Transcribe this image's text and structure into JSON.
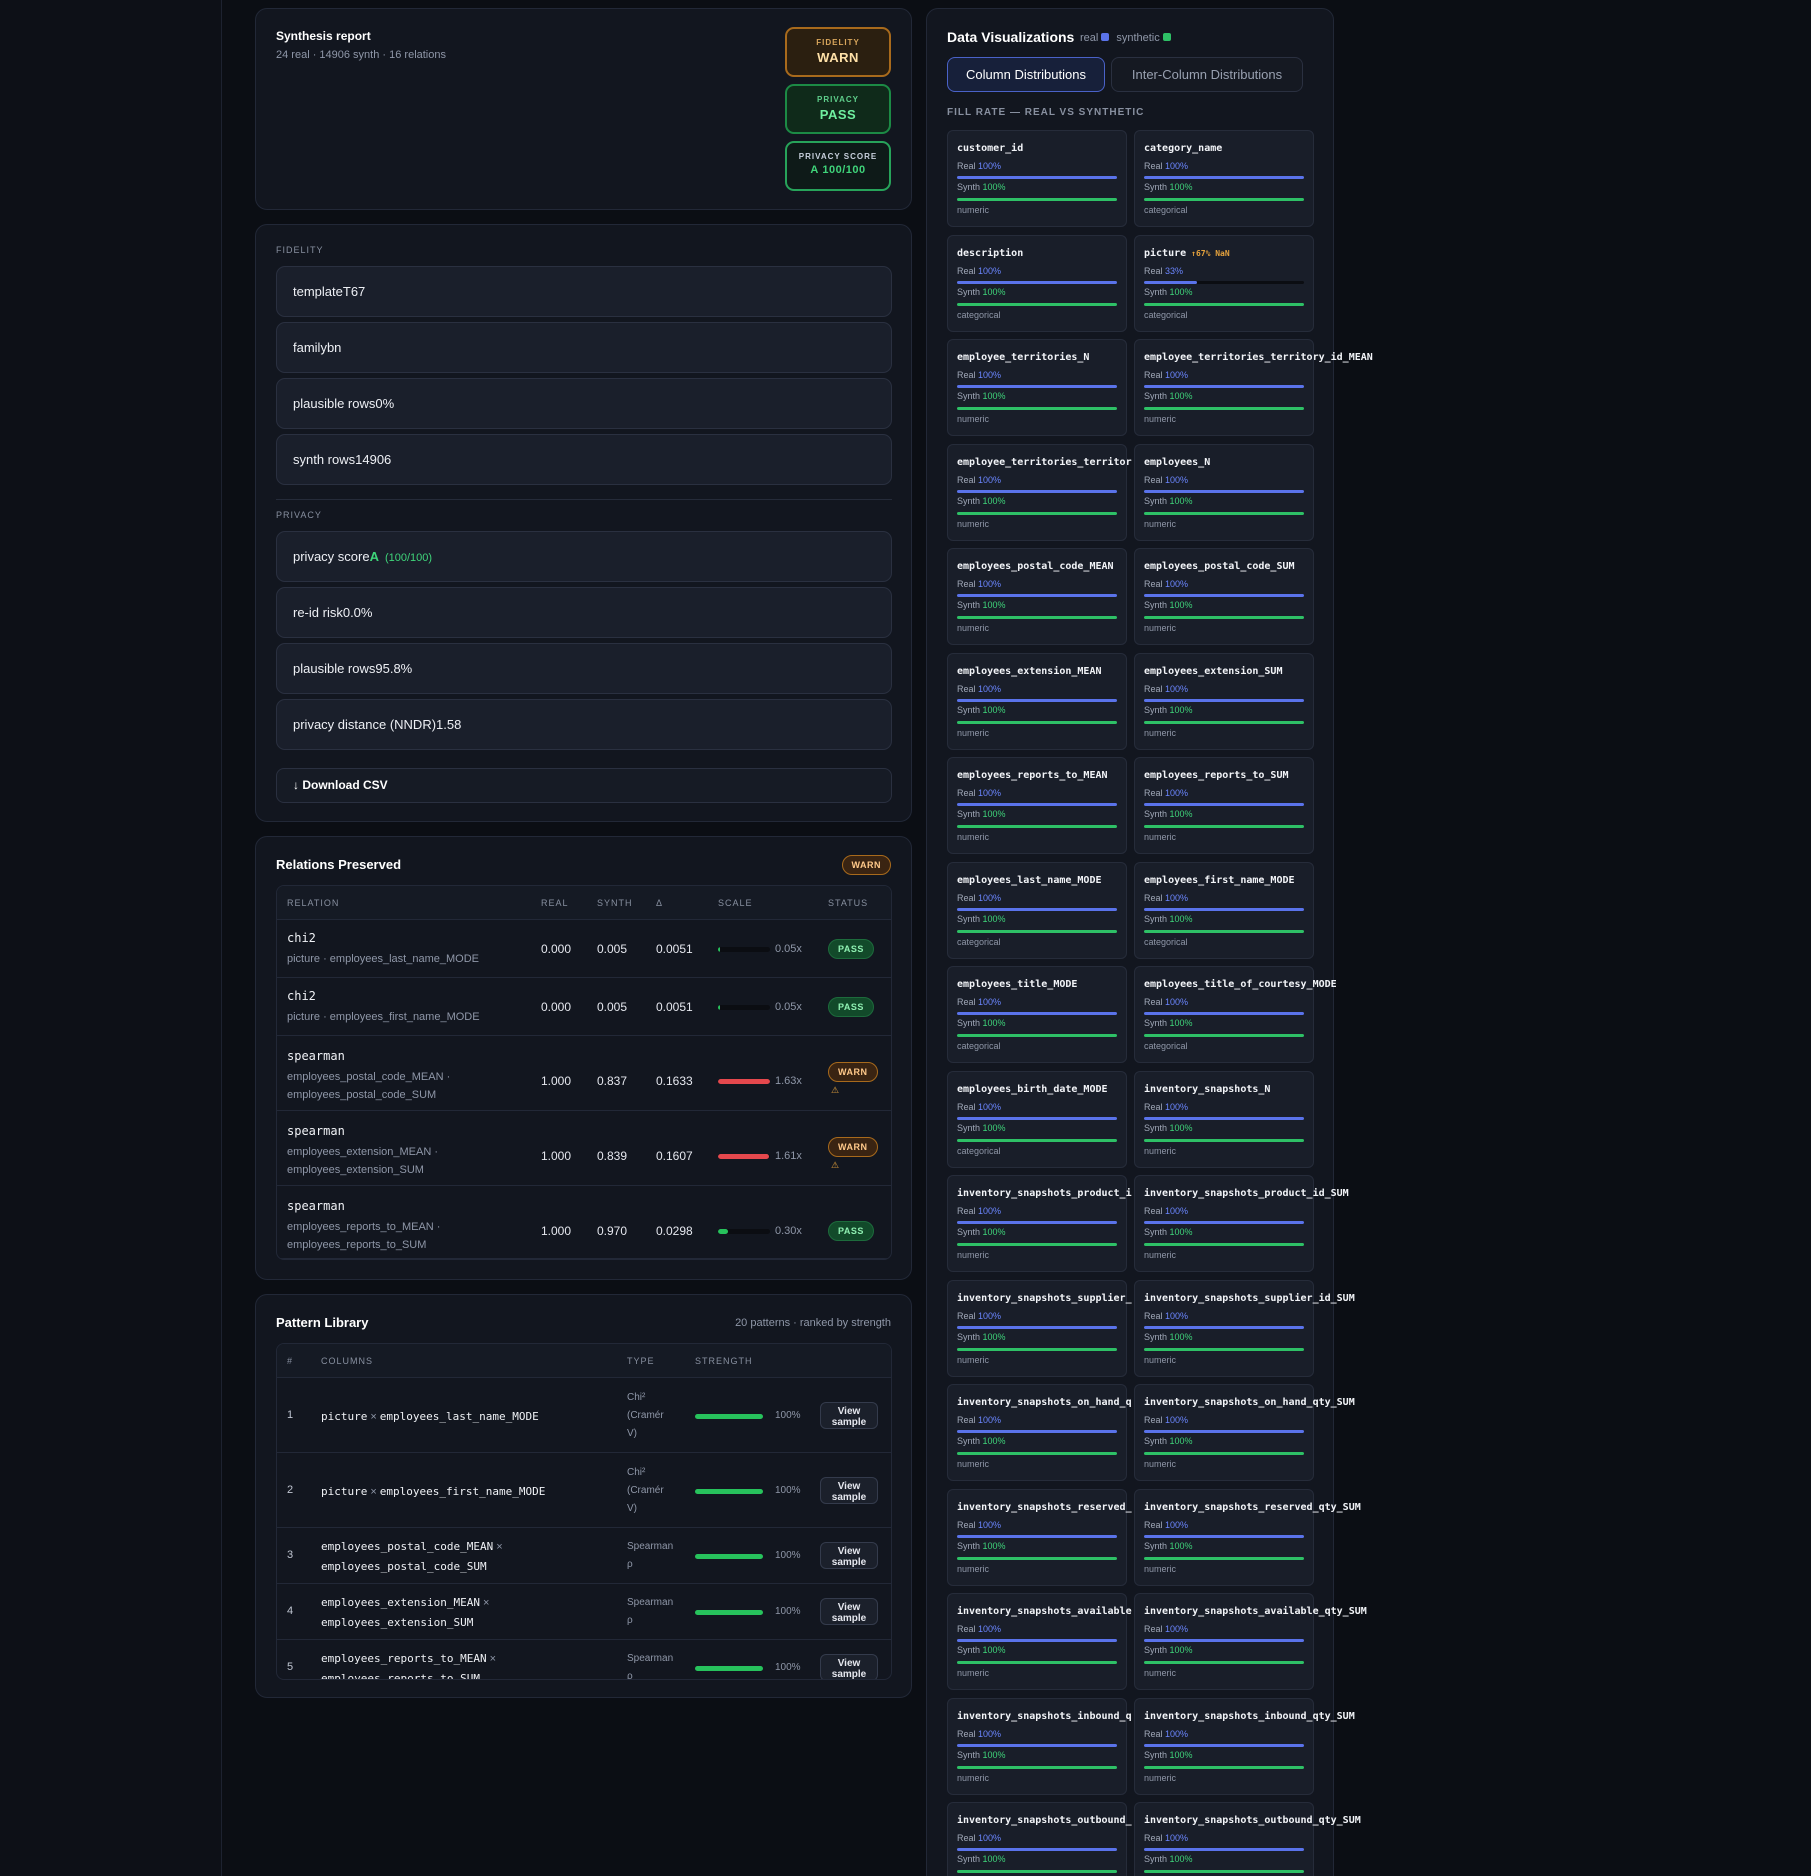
{
  "report": {
    "title": "Synthesis report",
    "subtitle": "24 real · 14906 synth · 16 relations",
    "badges": [
      {
        "label": "FIDELITY",
        "value": "WARN"
      },
      {
        "label": "PRIVACY",
        "value": "PASS"
      },
      {
        "label": "PRIVACY SCORE",
        "grade": "A",
        "value": "100/100"
      }
    ]
  },
  "metrics": {
    "fidelity_header": "FIDELITY",
    "fidelity": [
      {
        "label": "template",
        "value": "T67"
      },
      {
        "label": "family",
        "value": "bn"
      },
      {
        "label": "plausible rows",
        "value": "0%"
      },
      {
        "label": "synth rows",
        "value": "14906"
      }
    ],
    "privacy_header": "PRIVACY",
    "privacy_score": {
      "label": "privacy score",
      "grade": "A",
      "sub": "(100/100)"
    },
    "privacy": [
      {
        "label": "re-id risk",
        "value": "0.0%"
      },
      {
        "label": "plausible rows",
        "value": "95.8%"
      },
      {
        "label": "privacy distance (NNDR)",
        "value": "1.58"
      }
    ],
    "download_label": "↓ Download CSV"
  },
  "relations": {
    "title": "Relations Preserved",
    "status_badge": "WARN",
    "headers": [
      "RELATION",
      "REAL",
      "SYNTH",
      "Δ",
      "SCALE",
      "STATUS"
    ],
    "rows": [
      {
        "name": "chi2",
        "cols": [
          "picture · employees_last_name_MODE"
        ],
        "real": "0.000",
        "synth": "0.005",
        "delta": "0.0051",
        "scale_label": "0.05x",
        "scale": 0.05,
        "status": "PASS",
        "warn_icon": ""
      },
      {
        "name": "chi2",
        "cols": [
          "picture · employees_first_name_MODE"
        ],
        "real": "0.000",
        "synth": "0.005",
        "delta": "0.0051",
        "scale_label": "0.05x",
        "scale": 0.05,
        "status": "PASS",
        "warn_icon": ""
      },
      {
        "name": "spearman",
        "cols": [
          "employees_postal_code_MEAN ·",
          "employees_postal_code_SUM"
        ],
        "real": "1.000",
        "synth": "0.837",
        "delta": "0.1633",
        "scale_label": "1.63x",
        "scale": 1.63,
        "status": "WARN",
        "warn_icon": "⚠"
      },
      {
        "name": "spearman",
        "cols": [
          "employees_extension_MEAN ·",
          "employees_extension_SUM"
        ],
        "real": "1.000",
        "synth": "0.839",
        "delta": "0.1607",
        "scale_label": "1.61x",
        "scale": 1.61,
        "status": "WARN",
        "warn_icon": "⚠"
      },
      {
        "name": "spearman",
        "cols": [
          "employees_reports_to_MEAN ·",
          "employees_reports_to_SUM"
        ],
        "real": "1.000",
        "synth": "0.970",
        "delta": "0.0298",
        "scale_label": "0.30x",
        "scale": 0.3,
        "status": "PASS",
        "warn_icon": ""
      }
    ]
  },
  "patterns": {
    "title": "Pattern Library",
    "subtitle": "20 patterns · ranked by strength",
    "headers": [
      "#",
      "COLUMNS",
      "TYPE",
      "STRENGTH"
    ],
    "rows": [
      {
        "n": "1",
        "a": "picture",
        "b": "employees_last_name_MODE",
        "type": [
          "Chi²",
          "(Cramér",
          "V)"
        ],
        "strength": "100%",
        "button": "View sample"
      },
      {
        "n": "2",
        "a": "picture",
        "b": "employees_first_name_MODE",
        "type": [
          "Chi²",
          "(Cramér",
          "V)"
        ],
        "strength": "100%",
        "button": "View sample"
      },
      {
        "n": "3",
        "a": "employees_postal_code_MEAN",
        "b": "employees_postal_code_SUM",
        "type": [
          "Spearman",
          "ρ"
        ],
        "strength": "100%",
        "button": "View sample"
      },
      {
        "n": "4",
        "a": "employees_extension_MEAN",
        "b": "employees_extension_SUM",
        "type": [
          "Spearman",
          "ρ"
        ],
        "strength": "100%",
        "button": "View sample"
      },
      {
        "n": "5",
        "a": "employees_reports_to_MEAN",
        "b": "employees_reports_to_SUM",
        "type": [
          "Spearman",
          "ρ"
        ],
        "strength": "100%",
        "button": "View sample"
      }
    ],
    "times": "×"
  },
  "viz": {
    "title": "Data Visualizations",
    "legend_real": "real",
    "legend_synth": "synthetic",
    "colors": {
      "real": "#5a73ea",
      "synth": "#2ec066"
    },
    "tabs": [
      "Column Distributions",
      "Inter-Column Distributions"
    ],
    "section": "FILL RATE — REAL VS SYNTHETIC",
    "real_label": "Real",
    "synth_label": "Synth",
    "columns": [
      {
        "name": "customer_id",
        "real": "100%",
        "synth": "100%",
        "real_fill": 1,
        "synth_fill": 1,
        "type": "numeric",
        "nan": ""
      },
      {
        "name": "category_name",
        "real": "100%",
        "synth": "100%",
        "real_fill": 1,
        "synth_fill": 1,
        "type": "categorical",
        "nan": ""
      },
      {
        "name": "description",
        "real": "100%",
        "synth": "100%",
        "real_fill": 1,
        "synth_fill": 1,
        "type": "categorical",
        "nan": ""
      },
      {
        "name": "picture",
        "real": "33%",
        "synth": "100%",
        "real_fill": 0.33,
        "synth_fill": 1,
        "type": "categorical",
        "nan": "↑67% NaN"
      },
      {
        "name": "employee_territories_N",
        "real": "100%",
        "synth": "100%",
        "real_fill": 1,
        "synth_fill": 1,
        "type": "numeric",
        "nan": ""
      },
      {
        "name": "employee_territories_territory_id_MEAN",
        "real": "100%",
        "synth": "100%",
        "real_fill": 1,
        "synth_fill": 1,
        "type": "numeric",
        "nan": ""
      },
      {
        "name": "employee_territories_territor",
        "real": "100%",
        "synth": "100%",
        "real_fill": 1,
        "synth_fill": 1,
        "type": "numeric",
        "nan": ""
      },
      {
        "name": "employees_N",
        "real": "100%",
        "synth": "100%",
        "real_fill": 1,
        "synth_fill": 1,
        "type": "numeric",
        "nan": ""
      },
      {
        "name": "employees_postal_code_MEAN",
        "real": "100%",
        "synth": "100%",
        "real_fill": 1,
        "synth_fill": 1,
        "type": "numeric",
        "nan": ""
      },
      {
        "name": "employees_postal_code_SUM",
        "real": "100%",
        "synth": "100%",
        "real_fill": 1,
        "synth_fill": 1,
        "type": "numeric",
        "nan": ""
      },
      {
        "name": "employees_extension_MEAN",
        "real": "100%",
        "synth": "100%",
        "real_fill": 1,
        "synth_fill": 1,
        "type": "numeric",
        "nan": ""
      },
      {
        "name": "employees_extension_SUM",
        "real": "100%",
        "synth": "100%",
        "real_fill": 1,
        "synth_fill": 1,
        "type": "numeric",
        "nan": ""
      },
      {
        "name": "employees_reports_to_MEAN",
        "real": "100%",
        "synth": "100%",
        "real_fill": 1,
        "synth_fill": 1,
        "type": "numeric",
        "nan": ""
      },
      {
        "name": "employees_reports_to_SUM",
        "real": "100%",
        "synth": "100%",
        "real_fill": 1,
        "synth_fill": 1,
        "type": "numeric",
        "nan": ""
      },
      {
        "name": "employees_last_name_MODE",
        "real": "100%",
        "synth": "100%",
        "real_fill": 1,
        "synth_fill": 1,
        "type": "categorical",
        "nan": ""
      },
      {
        "name": "employees_first_name_MODE",
        "real": "100%",
        "synth": "100%",
        "real_fill": 1,
        "synth_fill": 1,
        "type": "categorical",
        "nan": ""
      },
      {
        "name": "employees_title_MODE",
        "real": "100%",
        "synth": "100%",
        "real_fill": 1,
        "synth_fill": 1,
        "type": "categorical",
        "nan": ""
      },
      {
        "name": "employees_title_of_courtesy_MODE",
        "real": "100%",
        "synth": "100%",
        "real_fill": 1,
        "synth_fill": 1,
        "type": "categorical",
        "nan": ""
      },
      {
        "name": "employees_birth_date_MODE",
        "real": "100%",
        "synth": "100%",
        "real_fill": 1,
        "synth_fill": 1,
        "type": "categorical",
        "nan": ""
      },
      {
        "name": "inventory_snapshots_N",
        "real": "100%",
        "synth": "100%",
        "real_fill": 1,
        "synth_fill": 1,
        "type": "numeric",
        "nan": ""
      },
      {
        "name": "inventory_snapshots_product_i",
        "real": "100%",
        "synth": "100%",
        "real_fill": 1,
        "synth_fill": 1,
        "type": "numeric",
        "nan": ""
      },
      {
        "name": "inventory_snapshots_product_id_SUM",
        "real": "100%",
        "synth": "100%",
        "real_fill": 1,
        "synth_fill": 1,
        "type": "numeric",
        "nan": ""
      },
      {
        "name": "inventory_snapshots_supplier_",
        "real": "100%",
        "synth": "100%",
        "real_fill": 1,
        "synth_fill": 1,
        "type": "numeric",
        "nan": ""
      },
      {
        "name": "inventory_snapshots_supplier_id_SUM",
        "real": "100%",
        "synth": "100%",
        "real_fill": 1,
        "synth_fill": 1,
        "type": "numeric",
        "nan": ""
      },
      {
        "name": "inventory_snapshots_on_hand_q",
        "real": "100%",
        "synth": "100%",
        "real_fill": 1,
        "synth_fill": 1,
        "type": "numeric",
        "nan": ""
      },
      {
        "name": "inventory_snapshots_on_hand_qty_SUM",
        "real": "100%",
        "synth": "100%",
        "real_fill": 1,
        "synth_fill": 1,
        "type": "numeric",
        "nan": ""
      },
      {
        "name": "inventory_snapshots_reserved_",
        "real": "100%",
        "synth": "100%",
        "real_fill": 1,
        "synth_fill": 1,
        "type": "numeric",
        "nan": ""
      },
      {
        "name": "inventory_snapshots_reserved_qty_SUM",
        "real": "100%",
        "synth": "100%",
        "real_fill": 1,
        "synth_fill": 1,
        "type": "numeric",
        "nan": ""
      },
      {
        "name": "inventory_snapshots_available",
        "real": "100%",
        "synth": "100%",
        "real_fill": 1,
        "synth_fill": 1,
        "type": "numeric",
        "nan": ""
      },
      {
        "name": "inventory_snapshots_available_qty_SUM",
        "real": "100%",
        "synth": "100%",
        "real_fill": 1,
        "synth_fill": 1,
        "type": "numeric",
        "nan": ""
      },
      {
        "name": "inventory_snapshots_inbound_q",
        "real": "100%",
        "synth": "100%",
        "real_fill": 1,
        "synth_fill": 1,
        "type": "numeric",
        "nan": ""
      },
      {
        "name": "inventory_snapshots_inbound_qty_SUM",
        "real": "100%",
        "synth": "100%",
        "real_fill": 1,
        "synth_fill": 1,
        "type": "numeric",
        "nan": ""
      },
      {
        "name": "inventory_snapshots_outbound_",
        "real": "100%",
        "synth": "100%",
        "real_fill": 1,
        "synth_fill": 1,
        "type": "numeric",
        "nan": ""
      },
      {
        "name": "inventory_snapshots_outbound_qty_SUM",
        "real": "100%",
        "synth": "100%",
        "real_fill": 1,
        "synth_fill": 1,
        "type": "numeric",
        "nan": ""
      }
    ]
  }
}
